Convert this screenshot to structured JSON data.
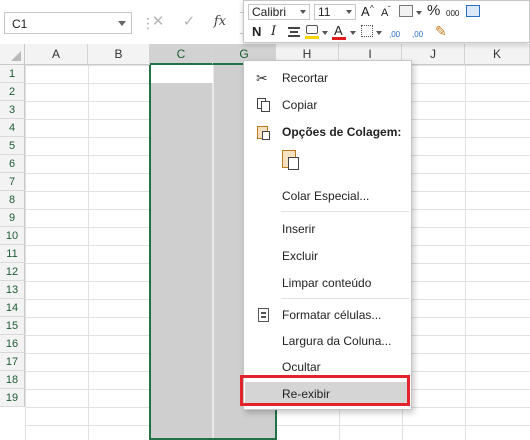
{
  "formula_bar": {
    "name_box": "C1",
    "cancel_glyph": "✕",
    "enter_glyph": "✓",
    "fx_label": "fx",
    "formula_value": ""
  },
  "columns": [
    "A",
    "B",
    "C",
    "G",
    "H",
    "I",
    "J",
    "K"
  ],
  "selected_columns": [
    "C",
    "G"
  ],
  "rows": [
    "1",
    "2",
    "3",
    "4",
    "5",
    "6",
    "7",
    "8",
    "9",
    "10",
    "11",
    "12",
    "13",
    "14",
    "15",
    "16",
    "17",
    "18",
    "19"
  ],
  "mini_toolbar": {
    "font_name": "Calibri",
    "font_size": "11",
    "grow_font": "A",
    "shrink_font": "A",
    "percent": "%",
    "thousands": "000",
    "bold": "N",
    "italic": "I",
    "font_color_letter": "A",
    "increase_decimal": ",00",
    "decrease_decimal": ",00",
    "font_color_hex": "#e01c1c",
    "fill_color_hex": "#ffd400"
  },
  "context_menu": {
    "items": [
      {
        "id": "recortar",
        "label": "Recortar",
        "icon": "scissors-icon"
      },
      {
        "id": "copiar",
        "label": "Copiar",
        "icon": "copy-icon"
      },
      {
        "id": "opcoes-colagem",
        "label": "Opções de Colagem:",
        "icon": "paste-options-icon"
      },
      {
        "id": "colar-especial",
        "label": "Colar Especial...",
        "icon": ""
      },
      {
        "id": "inserir",
        "label": "Inserir",
        "icon": ""
      },
      {
        "id": "excluir",
        "label": "Excluir",
        "icon": ""
      },
      {
        "id": "limpar-conteudo",
        "label": "Limpar conteúdo",
        "icon": ""
      },
      {
        "id": "formatar-celulas",
        "label": "Formatar células...",
        "icon": "format-cells-icon"
      },
      {
        "id": "largura-coluna",
        "label": "Largura da Coluna...",
        "icon": ""
      },
      {
        "id": "ocultar",
        "label": "Ocultar",
        "icon": ""
      },
      {
        "id": "re-exibir",
        "label": "Re-exibir",
        "icon": ""
      }
    ]
  },
  "colors": {
    "accent_green": "#217346",
    "highlight_red": "#e3242b",
    "selection_gray": "#cfcfcf",
    "hover_gray": "#d5d5d5"
  }
}
